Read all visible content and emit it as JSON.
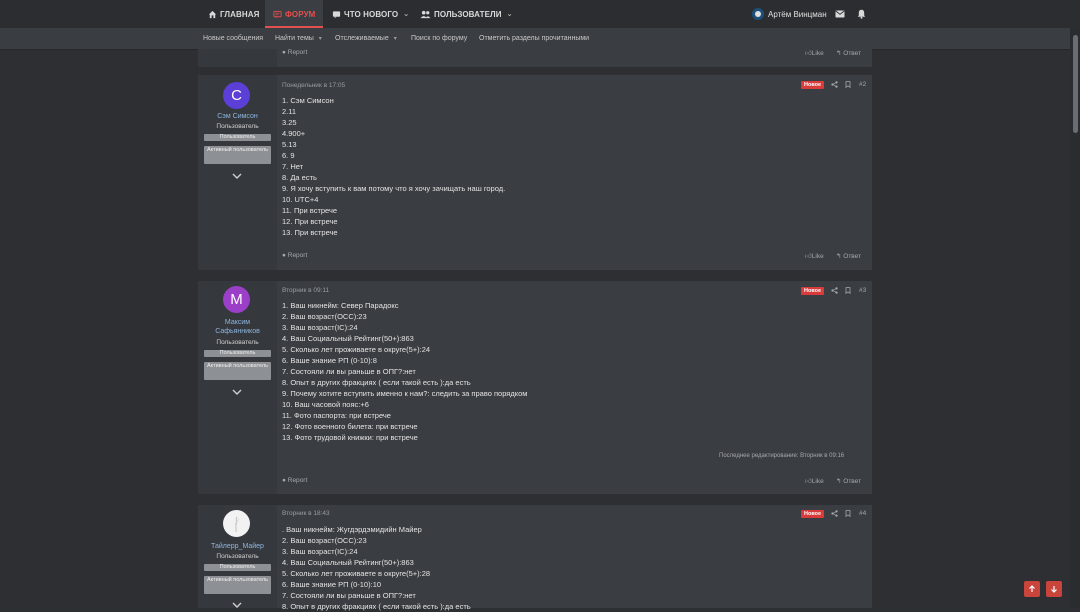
{
  "nav": {
    "home": "ГЛАВНАЯ",
    "forum": "ФОРУМ",
    "whats_new": "ЧТО НОВОГО",
    "users": "ПОЛЬЗОВАТЕЛИ"
  },
  "user": {
    "name": "Артём Винцман"
  },
  "subnav": {
    "new_posts": "Новые сообщения",
    "find_threads": "Найти темы",
    "watched": "Отслеживаемые",
    "search": "Поиск по форуму",
    "mark_read": "Отметить разделы прочитанными"
  },
  "prev_footer": {
    "report": "Report",
    "like": "Like",
    "reply": "Ответ"
  },
  "posts": [
    {
      "avatar_letter": "С",
      "avatar_color": "#5b3fd6",
      "username": "Сэм Симсон",
      "user_title": "Пользователь",
      "badge1": "Пользователь",
      "badge2": "Активный пользователь",
      "date": "Понедельник в 17:05",
      "new_label": "Новое",
      "number": "#2",
      "body": "1. Сэм Симсон\n2.11\n3.25\n4.900+\n5.13\n6. 9\n7. Нет\n8. Да есть\n9. Я хочу вступить к вам потому что я хочу зачищать наш город.\n10. UTC+4\n11. При встрече\n12. При встрече\n13. При встрече",
      "report": "Report",
      "like": "Like",
      "reply": "Ответ"
    },
    {
      "avatar_letter": "М",
      "avatar_color": "#9b3fc8",
      "username": "Максим Сафьянников",
      "user_title": "Пользователь",
      "badge1": "Пользователь",
      "badge2": "Активный пользователь",
      "date": "Вторник в 09:11",
      "new_label": "Новое",
      "number": "#3",
      "body": "1. Ваш никнейм: Север Парадокс\n2. Ваш возраст(OCC):23\n3. Ваш возраст(IC):24\n4. Ваш Социальный Рейтинг(50+):863\n5. Сколько лет проживаете в округе(5+):24\n6. Ваше знание РП (0-10):8\n7. Состояли ли вы раньше в ОПГ?:нет\n8. Опыт в других фракциях ( если такой есть ):да есть\n9. Почему хотите вступить именно к нам?: следить за право порядком\n10. Ваш часовой пояс:+6\n11. Фото паспорта: при встрече\n12. Фото военного билета: при встрече\n13. Фото трудовой книжки: при встрече",
      "edit_note": "Последнее редактирование: Вторник в 09:16",
      "report": "Report",
      "like": "Like",
      "reply": "Ответ"
    },
    {
      "avatar_letter": "",
      "avatar_color": "#f2f2f2",
      "username": "Тайлерр_Майер",
      "user_title": "Пользователь",
      "badge1": "Пользователь",
      "badge2": "Активный пользователь",
      "date": "Вторник в 18:43",
      "new_label": "Новое",
      "number": "#4",
      "body": ". Ваш никнейм: Жугдэрдэмидийн Майер\n2. Ваш возраст(OCC):23\n3. Ваш возраст(IC):24\n4. Ваш Социальный Рейтинг(50+):863\n5. Сколько лет проживаете в округе(5+):28\n6. Ваше знание РП (0-10):10\n7. Состояли ли вы раньше в ОПГ?:нет\n8. Опыт в других фракциях ( если такой есть ):да есть"
    }
  ],
  "colors": {
    "accent": "#e24f4f",
    "new_badge": "#d93a3a",
    "fab": "#c9443a"
  }
}
